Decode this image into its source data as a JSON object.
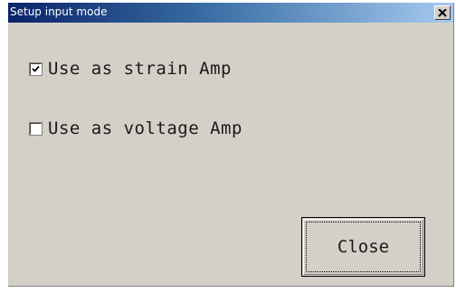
{
  "window": {
    "title": "Setup input mode",
    "close_glyph": "✕"
  },
  "options": [
    {
      "label": "Use as strain Amp",
      "checked": true
    },
    {
      "label": "Use as voltage Amp",
      "checked": false
    }
  ],
  "buttons": {
    "close_label": "Close"
  },
  "colors": {
    "face": "#d4d0c8",
    "titlebar_start": "#0a246a",
    "titlebar_end": "#a6caf0"
  }
}
